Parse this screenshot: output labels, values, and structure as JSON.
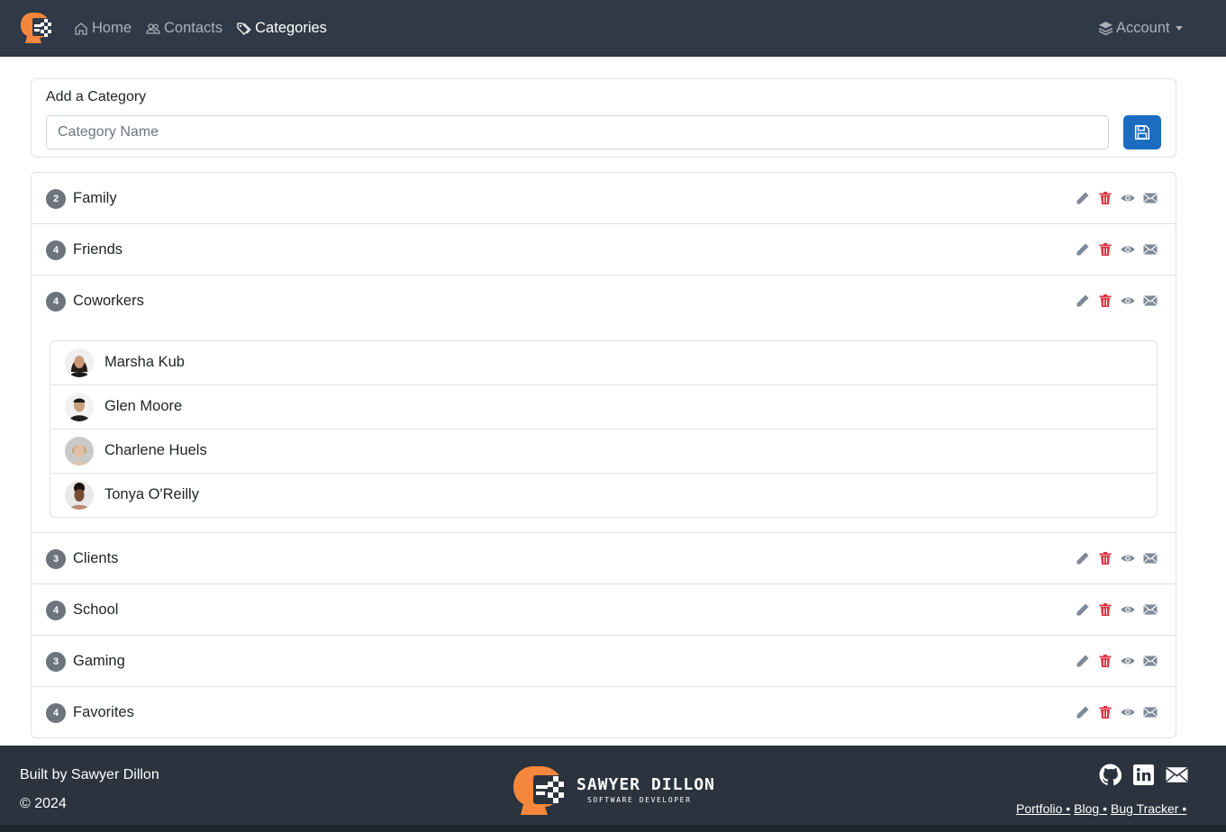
{
  "navbar": {
    "links": [
      {
        "label": "Home",
        "icon": "house-icon",
        "active": false
      },
      {
        "label": "Contacts",
        "icon": "people-icon",
        "active": false
      },
      {
        "label": "Categories",
        "icon": "tags-icon",
        "active": true
      }
    ],
    "account_label": "Account"
  },
  "add_category": {
    "title": "Add a Category",
    "placeholder": "Category Name",
    "value": "",
    "save_icon": "floppy-disk-icon",
    "save_color": "#1c6dc2"
  },
  "categories": [
    {
      "count": "2",
      "name": "Family"
    },
    {
      "count": "4",
      "name": "Friends"
    },
    {
      "count": "4",
      "name": "Coworkers",
      "expanded": true,
      "contacts": [
        {
          "name": "Marsha Kub"
        },
        {
          "name": "Glen Moore"
        },
        {
          "name": "Charlene Huels"
        },
        {
          "name": "Tonya O'Reilly"
        }
      ]
    },
    {
      "count": "3",
      "name": "Clients"
    },
    {
      "count": "4",
      "name": "School"
    },
    {
      "count": "3",
      "name": "Gaming"
    },
    {
      "count": "4",
      "name": "Favorites"
    }
  ],
  "row_actions": [
    {
      "icon": "pencil-icon",
      "color": "#7f8a99"
    },
    {
      "icon": "trash-icon",
      "color": "#dc3545"
    },
    {
      "icon": "eye-icon",
      "color": "#7f8a99"
    },
    {
      "icon": "envelope-icon",
      "color": "#7f8a99"
    }
  ],
  "colors": {
    "navbar_bg": "#2f3947",
    "footer_bg": "#2b333e",
    "brand_orange": "#f5873c",
    "badge_bg": "#6c757d"
  },
  "footer": {
    "built_by": "Built by Sawyer Dillon",
    "copyright": "© 2024",
    "brand_name": "SAWYER DILLON",
    "brand_subtitle": "SOFTWARE DEVELOPER",
    "social_icons": [
      "github-icon",
      "linkedin-icon",
      "envelope-icon"
    ],
    "links": [
      "Portfolio",
      "Blog",
      "Bug Tracker"
    ],
    "link_separator": "•"
  }
}
